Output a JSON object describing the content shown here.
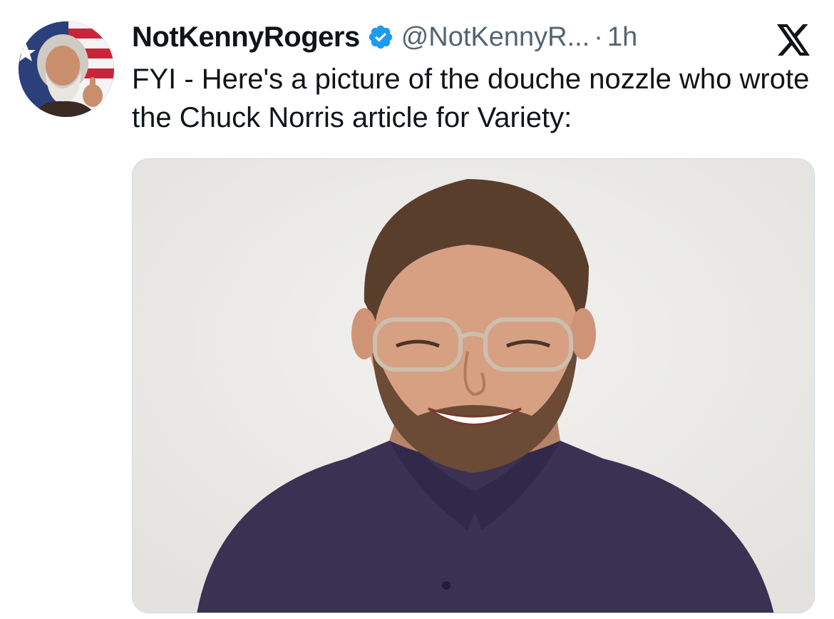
{
  "tweet": {
    "display_name": "NotKennyRogers",
    "handle": "@NotKennyR...",
    "separator": "·",
    "timestamp": "1h",
    "text": "FYI - Here's a picture of the douche nozzle who wrote the Chuck Norris article for Variety:",
    "verified": true,
    "avatar_icon": "avatar-photo",
    "platform_icon": "x-logo-icon",
    "media_icon": "attached-photo"
  },
  "colors": {
    "text_primary": "#0f1419",
    "text_secondary": "#536471",
    "verified_blue": "#1d9bf0",
    "border": "#cfd9de"
  }
}
